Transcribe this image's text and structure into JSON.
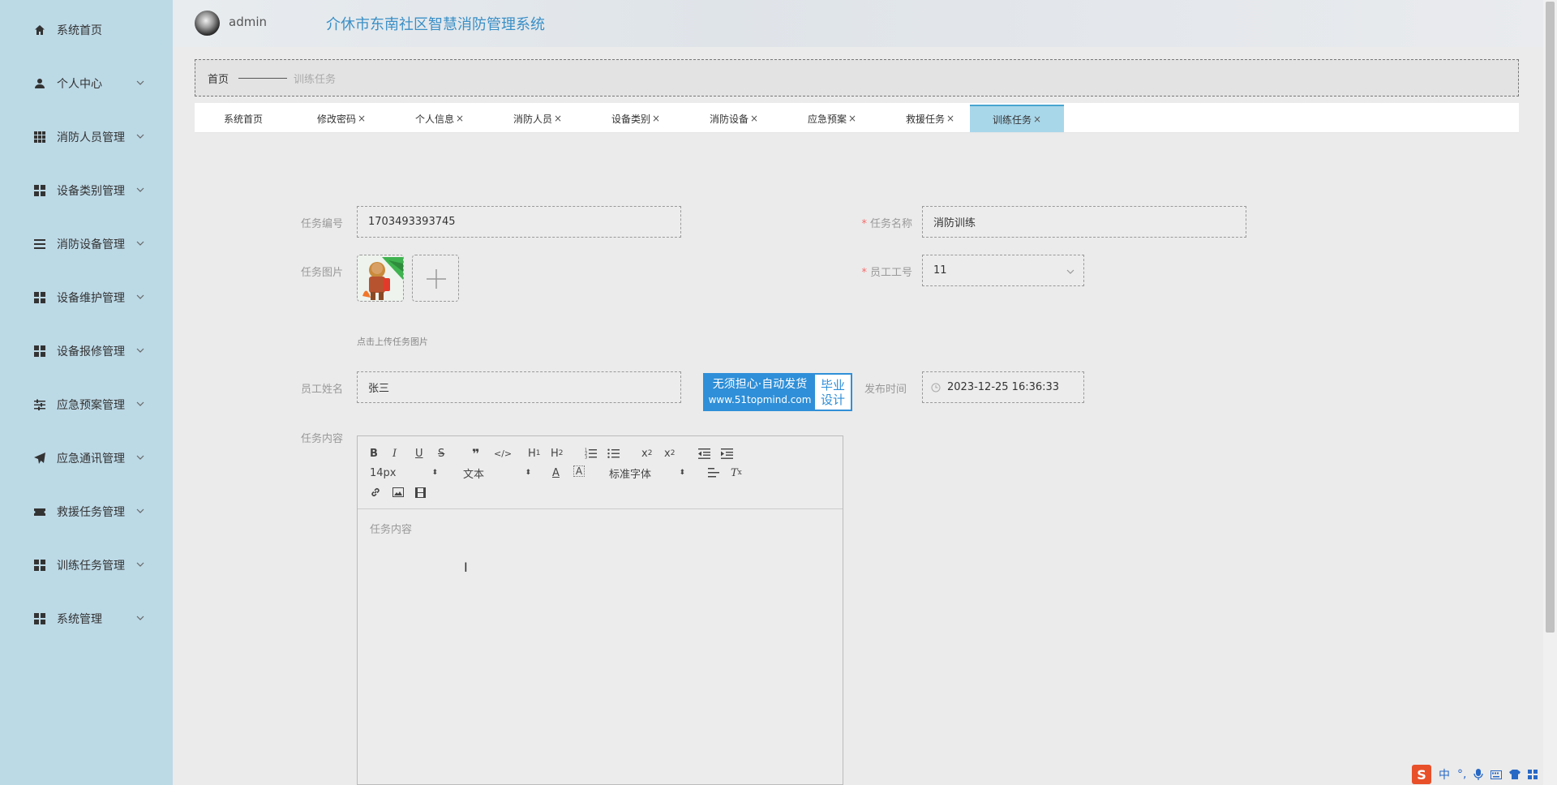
{
  "app": {
    "title": "介休市东南社区智慧消防管理系统",
    "username": "admin"
  },
  "sidebar": {
    "items": [
      {
        "label": "系统首页",
        "icon": "home-icon"
      },
      {
        "label": "个人中心",
        "icon": "user-icon"
      },
      {
        "label": "消防人员管理",
        "icon": "grid-icon"
      },
      {
        "label": "设备类别管理",
        "icon": "grid-icon"
      },
      {
        "label": "消防设备管理",
        "icon": "list-icon"
      },
      {
        "label": "设备维护管理",
        "icon": "grid-icon"
      },
      {
        "label": "设备报修管理",
        "icon": "grid-icon"
      },
      {
        "label": "应急预案管理",
        "icon": "sliders-icon"
      },
      {
        "label": "应急通讯管理",
        "icon": "send-icon"
      },
      {
        "label": "救援任务管理",
        "icon": "ticket-icon"
      },
      {
        "label": "训练任务管理",
        "icon": "grid-icon"
      },
      {
        "label": "系统管理",
        "icon": "grid-icon"
      }
    ]
  },
  "breadcrumb": {
    "home": "首页",
    "current": "训练任务"
  },
  "tabs": [
    {
      "label": "系统首页",
      "closable": false
    },
    {
      "label": "修改密码",
      "closable": true
    },
    {
      "label": "个人信息",
      "closable": true
    },
    {
      "label": "消防人员",
      "closable": true
    },
    {
      "label": "设备类别",
      "closable": true
    },
    {
      "label": "消防设备",
      "closable": true
    },
    {
      "label": "应急预案",
      "closable": true
    },
    {
      "label": "救援任务",
      "closable": true
    },
    {
      "label": "训练任务",
      "closable": true,
      "active": true
    }
  ],
  "tab_close_glyph": "×",
  "form": {
    "task_no_label": "任务编号",
    "task_no_value": "1703493393745",
    "task_name_label": "任务名称",
    "task_name_value": "消防训练",
    "task_image_label": "任务图片",
    "upload_hint": "点击上传任务图片",
    "emp_no_label": "员工工号",
    "emp_no_value": "11",
    "emp_name_label": "员工姓名",
    "emp_name_value": "张三",
    "publish_time_label": "发布时间",
    "publish_time_value": "2023-12-25 16:36:33",
    "content_label": "任务内容",
    "content_placeholder": "任务内容",
    "required_mark": "*"
  },
  "editor_toolbar": {
    "font_size": "14px",
    "paragraph": "文本",
    "font_family": "标准字体",
    "buttons": [
      "bold-icon",
      "italic-icon",
      "underline-icon",
      "strike-icon",
      "quote-icon",
      "code-icon",
      "h1-icon",
      "h2-icon",
      "ordered-list-icon",
      "bullet-list-icon",
      "subscript-icon",
      "superscript-icon",
      "outdent-icon",
      "indent-icon",
      "font-color-icon",
      "background-color-icon",
      "align-icon",
      "clear-format-icon",
      "link-icon",
      "image-icon",
      "video-icon"
    ]
  },
  "ad": {
    "line1": "无须担心·自动发货",
    "line2": "www.51topmind.com",
    "right1": "毕业",
    "right2": "设计"
  },
  "ime": {
    "lang": "中",
    "punct": "°,"
  },
  "colors": {
    "sidebar_bg": "#bcd9e6",
    "accent": "#3a8fc6",
    "active_tab": "#a9d7ea",
    "required": "#f56c6c"
  }
}
